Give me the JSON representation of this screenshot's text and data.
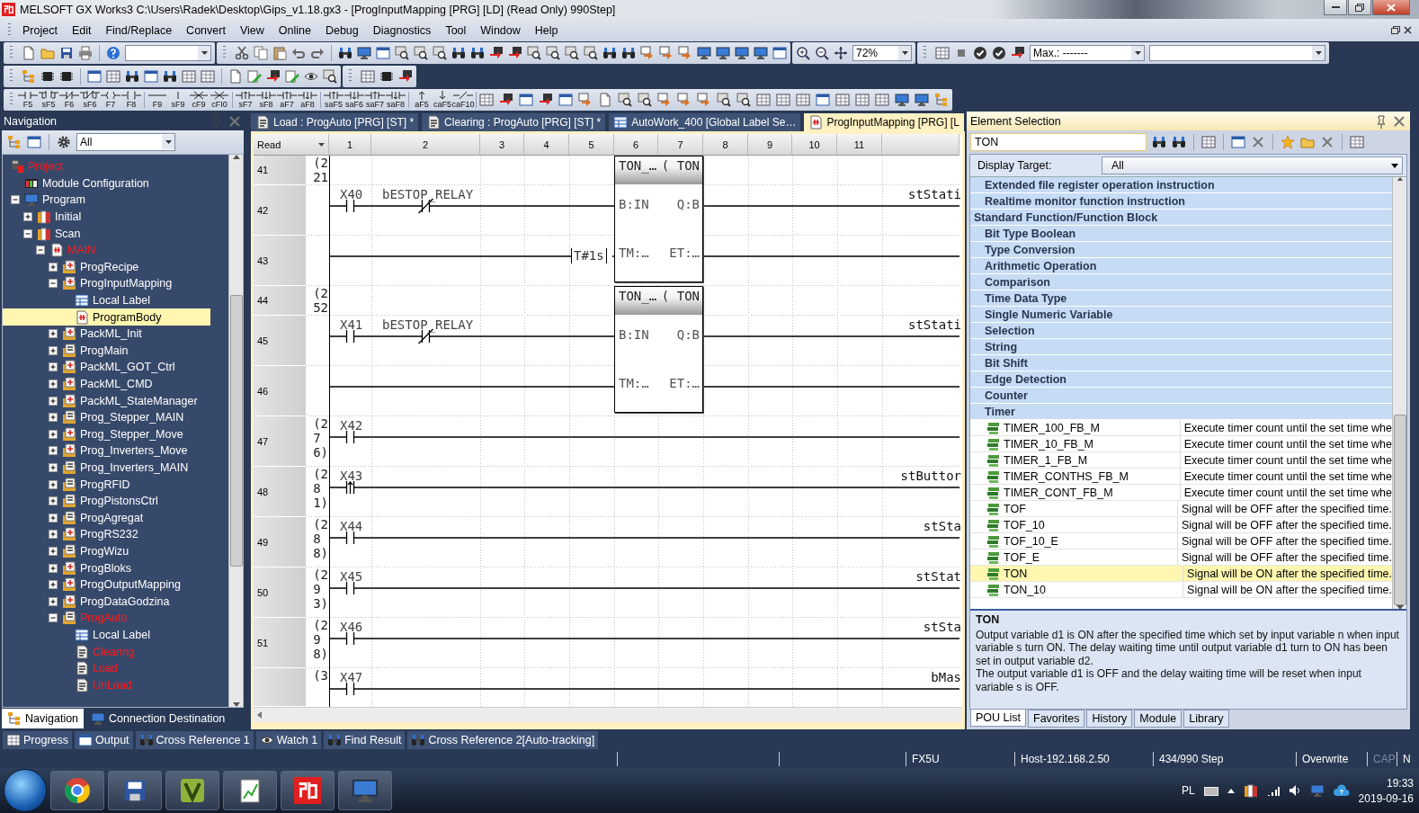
{
  "window": {
    "title": "MELSOFT GX Works3 C:\\Users\\Radek\\Desktop\\Gips_v1.18.gx3 - [ProgInputMapping [PRG] [LD] (Read Only) 990Step]"
  },
  "menu": [
    "Project",
    "Edit",
    "Find/Replace",
    "Convert",
    "View",
    "Online",
    "Debug",
    "Diagnostics",
    "Tool",
    "Window",
    "Help"
  ],
  "toolbar": {
    "zoom": "72%",
    "max": "Max.: -------"
  },
  "ladder_keys": [
    "F5",
    "sF5",
    "F6",
    "sF6",
    "F7",
    "F8",
    "F9",
    "sF9",
    "cF9",
    "cFI0",
    "sF7",
    "sF8",
    "aF7",
    "aF8",
    "saF5",
    "saF6",
    "saF7",
    "saF8",
    "aF5",
    "caF5",
    "caF10"
  ],
  "navigation": {
    "title": "Navigation",
    "filter": "All",
    "tree": [
      {
        "label": "Project",
        "kind": "project",
        "unconverted": true,
        "selected": false,
        "children": [
          {
            "label": "Module Configuration",
            "kind": "module",
            "unconverted": false,
            "selected": false
          },
          {
            "label": "Program",
            "kind": "program",
            "unconverted": false,
            "selected": false,
            "expanded": true,
            "children": [
              {
                "label": "Initial",
                "kind": "task",
                "unconverted": false,
                "selected": false,
                "expanded": false
              },
              {
                "label": "Scan",
                "kind": "task",
                "unconverted": false,
                "selected": false,
                "expanded": true,
                "children": [
                  {
                    "label": "MAIN",
                    "kind": "main",
                    "unconverted": true,
                    "selected": false,
                    "expanded": true,
                    "children": [
                      {
                        "label": "ProgRecipe",
                        "kind": "ld",
                        "unconverted": false,
                        "selected": false,
                        "expanded": false
                      },
                      {
                        "label": "ProgInputMapping",
                        "kind": "ld",
                        "unconverted": false,
                        "selected": false,
                        "expanded": true,
                        "children": [
                          {
                            "label": "Local Label",
                            "kind": "label",
                            "unconverted": false,
                            "selected": false
                          },
                          {
                            "label": "ProgramBody",
                            "kind": "body",
                            "unconverted": false,
                            "selected": true
                          }
                        ]
                      },
                      {
                        "label": "PackML_Init",
                        "kind": "ld",
                        "unconverted": false,
                        "selected": false,
                        "expanded": false
                      },
                      {
                        "label": "ProgMain",
                        "kind": "st",
                        "unconverted": false,
                        "selected": false,
                        "expanded": false
                      },
                      {
                        "label": "PackML_GOT_Ctrl",
                        "kind": "ld",
                        "unconverted": false,
                        "selected": false,
                        "expanded": false
                      },
                      {
                        "label": "PackML_CMD",
                        "kind": "ld",
                        "unconverted": false,
                        "selected": false,
                        "expanded": false
                      },
                      {
                        "label": "PackML_StateManager",
                        "kind": "ld",
                        "unconverted": false,
                        "selected": false,
                        "expanded": false
                      },
                      {
                        "label": "Prog_Stepper_MAIN",
                        "kind": "st",
                        "unconverted": false,
                        "selected": false,
                        "expanded": false
                      },
                      {
                        "label": "Prog_Stepper_Move",
                        "kind": "ld",
                        "unconverted": false,
                        "selected": false,
                        "expanded": false
                      },
                      {
                        "label": "Prog_Inverters_Move",
                        "kind": "ld",
                        "unconverted": false,
                        "selected": false,
                        "expanded": false
                      },
                      {
                        "label": "Prog_Inverters_MAIN",
                        "kind": "st",
                        "unconverted": false,
                        "selected": false,
                        "expanded": false
                      },
                      {
                        "label": "ProgRFID",
                        "kind": "st",
                        "unconverted": false,
                        "selected": false,
                        "expanded": false
                      },
                      {
                        "label": "ProgPistonsCtrl",
                        "kind": "st",
                        "unconverted": false,
                        "selected": false,
                        "expanded": false
                      },
                      {
                        "label": "ProgAgregat",
                        "kind": "st",
                        "unconverted": false,
                        "selected": false,
                        "expanded": false
                      },
                      {
                        "label": "ProgRS232",
                        "kind": "ld",
                        "unconverted": false,
                        "selected": false,
                        "expanded": false
                      },
                      {
                        "label": "ProgWizu",
                        "kind": "st",
                        "unconverted": false,
                        "selected": false,
                        "expanded": false
                      },
                      {
                        "label": "ProgBloks",
                        "kind": "ld",
                        "unconverted": false,
                        "selected": false,
                        "expanded": false
                      },
                      {
                        "label": "ProgOutputMapping",
                        "kind": "ld",
                        "unconverted": false,
                        "selected": false,
                        "expanded": false
                      },
                      {
                        "label": "ProgDataGodzina",
                        "kind": "ld",
                        "unconverted": false,
                        "selected": false,
                        "expanded": false
                      },
                      {
                        "label": "ProgAuto",
                        "kind": "st",
                        "unconverted": true,
                        "selected": false,
                        "expanded": true,
                        "children": [
                          {
                            "label": "Local Label",
                            "kind": "label",
                            "unconverted": false,
                            "selected": false
                          },
                          {
                            "label": "Clearing",
                            "kind": "stbody",
                            "unconverted": true,
                            "selected": false
                          },
                          {
                            "label": "Load",
                            "kind": "stbody",
                            "unconverted": true,
                            "selected": false
                          },
                          {
                            "label": "UnLoad",
                            "kind": "stbody",
                            "unconverted": true,
                            "selected": false
                          }
                        ]
                      }
                    ]
                  }
                ]
              }
            ]
          }
        ]
      }
    ],
    "tabs": [
      {
        "label": "Navigation",
        "selected": true
      },
      {
        "label": "Connection Destination",
        "selected": false
      }
    ]
  },
  "editor": {
    "tabs": [
      {
        "label": "Load : ProgAuto [PRG] [ST] *",
        "kind": "st",
        "selected": false
      },
      {
        "label": "Clearing : ProgAuto [PRG] [ST] *",
        "kind": "st",
        "selected": false
      },
      {
        "label": "AutoWork_400 [Global Label Se…",
        "kind": "label",
        "selected": false
      },
      {
        "label": "ProgInputMapping [PRG] [L",
        "kind": "ld",
        "selected": true
      }
    ],
    "mode": "Read",
    "columns": [
      "1",
      "2",
      "3",
      "4",
      "5",
      "6",
      "7",
      "8",
      "9",
      "10",
      "11"
    ],
    "rows": [
      {
        "number": "41",
        "step": "(221",
        "block": {
          "name": "TON_…",
          "type": "( TON",
          "pins": [
            {
              "input": "B:IN",
              "output": "Q:B"
            },
            {
              "input": "TM:…",
              "output": "ET:…",
              "constant": "T#1s"
            }
          ]
        }
      },
      {
        "number": "42",
        "contacts": [
          {
            "device": "X40",
            "kind": "no"
          },
          {
            "device": "bESTOP_RELAY",
            "kind": "nc"
          }
        ],
        "output": "stStati"
      },
      {
        "number": "43"
      },
      {
        "number": "44",
        "step": "(252",
        "block": {
          "name": "TON_…",
          "type": "( TON",
          "pins": [
            {
              "input": "B:IN",
              "output": "Q:B"
            },
            {
              "input": "TM:…",
              "output": "ET:…"
            }
          ]
        }
      },
      {
        "number": "45",
        "contacts": [
          {
            "device": "X41",
            "kind": "no"
          },
          {
            "device": "bESTOP_RELAY",
            "kind": "nc"
          }
        ],
        "output": "stStati"
      },
      {
        "number": "46"
      },
      {
        "number": "47",
        "step": "(276)",
        "contacts": [
          {
            "device": "X42",
            "kind": "no"
          }
        ]
      },
      {
        "number": "48",
        "step": "(281)",
        "contacts": [
          {
            "device": "X43",
            "kind": "rising"
          }
        ],
        "output": "stButtor"
      },
      {
        "number": "49",
        "step": "(288)",
        "contacts": [
          {
            "device": "X44",
            "kind": "no"
          }
        ],
        "output": "stSta"
      },
      {
        "number": "50",
        "step": "(293)",
        "contacts": [
          {
            "device": "X45",
            "kind": "no"
          }
        ],
        "output": "stStat"
      },
      {
        "number": "51",
        "step": "(298)",
        "contacts": [
          {
            "device": "X46",
            "kind": "no"
          }
        ],
        "output": "stSta"
      },
      {
        "step": "(3",
        "contacts": [
          {
            "device": "X47",
            "kind": "no"
          }
        ],
        "output": "bMas"
      }
    ]
  },
  "element_selection": {
    "title": "Element Selection",
    "search": "TON",
    "display_target_label": "Display Target:",
    "display_target": "All",
    "list": [
      {
        "label": "Extended file register operation instruction",
        "kind": "subcategory"
      },
      {
        "label": "Realtime monitor function instruction",
        "kind": "subcategory"
      },
      {
        "label": "Standard Function/Function Block",
        "kind": "category",
        "children": [
          {
            "label": "Bit Type Boolean",
            "kind": "subcategory"
          },
          {
            "label": "Type Conversion",
            "kind": "subcategory"
          },
          {
            "label": "Arithmetic Operation",
            "kind": "subcategory"
          },
          {
            "label": "Comparison",
            "kind": "subcategory"
          },
          {
            "label": "Time Data Type",
            "kind": "subcategory"
          },
          {
            "label": "Single Numeric Variable",
            "kind": "subcategory"
          },
          {
            "label": "Selection",
            "kind": "subcategory"
          },
          {
            "label": "String",
            "kind": "subcategory"
          },
          {
            "label": "Bit Shift",
            "kind": "subcategory"
          },
          {
            "label": "Edge Detection",
            "kind": "subcategory"
          },
          {
            "label": "Counter",
            "kind": "subcategory"
          },
          {
            "label": "Timer",
            "kind": "subcategory",
            "children": [
              {
                "label": "TIMER_100_FB_M",
                "kind": "pou",
                "description": "Execute timer count until the set time whe",
                "selected": false
              },
              {
                "label": "TIMER_10_FB_M",
                "kind": "pou",
                "description": "Execute timer count until the set time whe",
                "selected": false
              },
              {
                "label": "TIMER_1_FB_M",
                "kind": "pou",
                "description": "Execute timer count until the set time whe",
                "selected": false
              },
              {
                "label": "TIMER_CONTHS_FB_M",
                "kind": "pou",
                "description": "Execute timer count until the set time whe",
                "selected": false
              },
              {
                "label": "TIMER_CONT_FB_M",
                "kind": "pou",
                "description": "Execute timer count until the set time whe",
                "selected": false
              },
              {
                "label": "TOF",
                "kind": "pou",
                "description": "Signal will be OFF after the specified time.",
                "selected": false
              },
              {
                "label": "TOF_10",
                "kind": "pou",
                "description": "Signal will be OFF after the specified time.",
                "selected": false
              },
              {
                "label": "TOF_10_E",
                "kind": "pou",
                "description": "Signal will be OFF after the specified time.",
                "selected": false
              },
              {
                "label": "TOF_E",
                "kind": "pou",
                "description": "Signal will be OFF after the specified time.",
                "selected": false
              },
              {
                "label": "TON",
                "kind": "pou",
                "description": "Signal will be ON after the specified time.",
                "selected": true
              },
              {
                "label": "TON_10",
                "kind": "pou",
                "description": "Signal will be ON after the specified time.",
                "selected": false
              }
            ]
          }
        ]
      }
    ],
    "detail": {
      "title": "TON",
      "paragraphs": [
        "Output variable d1 is ON after the specified time which set by input variable n when input variable s turn ON. The delay waiting time until output variable d1 turn to ON has been set in output variable d2.",
        "The output variable d1 is OFF and the delay waiting time will be reset when input variable s is OFF."
      ]
    },
    "tabs": [
      {
        "label": "POU List",
        "selected": true
      },
      {
        "label": "Favorites",
        "selected": false
      },
      {
        "label": "History",
        "selected": false
      },
      {
        "label": "Module",
        "selected": false
      },
      {
        "label": "Library",
        "selected": false
      }
    ]
  },
  "output_tabs": [
    "Progress",
    "Output",
    "Cross Reference 1",
    "Watch 1",
    "Find Result",
    "Cross Reference 2[Auto-tracking]"
  ],
  "status_bar": [
    {
      "text": "FX5U",
      "disabled": false
    },
    {
      "text": "Host-192.168.2.50",
      "disabled": false
    },
    {
      "text": "434/990 Step",
      "disabled": false
    },
    {
      "text": "Overwrite",
      "disabled": false
    },
    {
      "text": "CAP",
      "disabled": true
    },
    {
      "text": "N",
      "disabled": false
    }
  ],
  "taskbar": {
    "language": "PL",
    "time": "19:33",
    "date": "2019-09-16"
  }
}
